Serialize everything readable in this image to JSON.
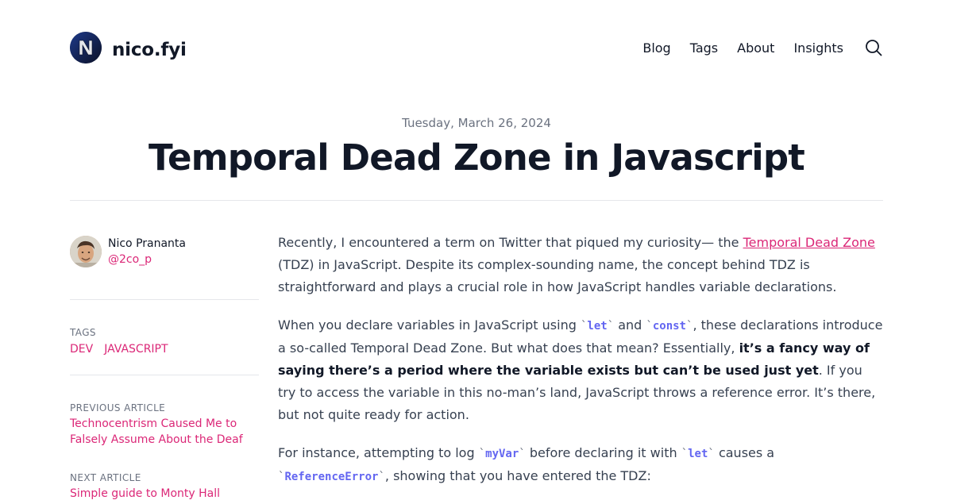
{
  "header": {
    "site_name": "nico.fyi",
    "logo_letter": "N",
    "nav": [
      {
        "label": "Blog"
      },
      {
        "label": "Tags"
      },
      {
        "label": "About"
      },
      {
        "label": "Insights"
      }
    ],
    "search_icon": "search-icon"
  },
  "post": {
    "date": "Tuesday, March 26, 2024",
    "title": "Temporal Dead Zone in Javascript"
  },
  "sidebar": {
    "author_name": "Nico Prananta",
    "author_handle": "@2co_p",
    "tags_label": "TAGS",
    "tags": [
      "DEV",
      "JAVASCRIPT"
    ],
    "previous_label": "PREVIOUS ARTICLE",
    "previous_title": "Technocentrism Caused Me to Falsely Assume About the Deaf",
    "next_label": "NEXT ARTICLE",
    "next_title": "Simple guide to Monty Hall"
  },
  "content": {
    "p1_a": "Recently, I encountered a term on Twitter that piqued my curiosity— the ",
    "p1_link": "Temporal Dead Zone",
    "p1_b": " (TDZ) in JavaScript. Despite its complex-sounding name, the concept behind TDZ is straightforward and plays a crucial role in how JavaScript handles variable declarations.",
    "p2_a": "When you declare variables in JavaScript using ",
    "p2_code1": "let",
    "p2_b": " and ",
    "p2_code2": "const",
    "p2_c": ", these declarations introduce a so-called Temporal Dead Zone. But what does that mean? Essentially, ",
    "p2_bold": "it’s a fancy way of saying there’s a period where the variable exists but can’t be used just yet",
    "p2_d": ". If you try to access the variable in this no-man’s land, JavaScript throws a reference error. It’s there, but not quite ready for action.",
    "p3_a": "For instance, attempting to log ",
    "p3_code1": "myVar",
    "p3_b": " before declaring it with ",
    "p3_code2": "let",
    "p3_c": " causes a ",
    "p3_code3": "ReferenceError",
    "p3_d": ", showing that you have entered the TDZ:",
    "backtick": "`"
  }
}
